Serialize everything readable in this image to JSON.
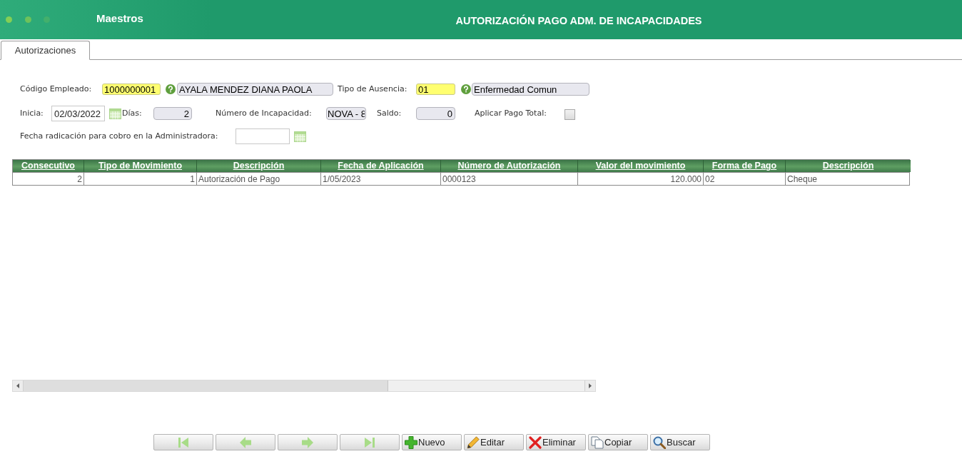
{
  "window": {
    "section": "Maestros",
    "title": "AUTORIZACIÓN PAGO ADM. DE INCAPACIDADES"
  },
  "tabs": [
    {
      "label": "Autorizaciones",
      "selected": true
    }
  ],
  "form": {
    "employee": {
      "label": "Código Empleado:",
      "code": "1000000001",
      "name": "AYALA MENDEZ DIANA PAOLA"
    },
    "absence_type": {
      "label": "Tipo de Ausencia:",
      "code": "01",
      "name": "Enfermedad Comun"
    },
    "start": {
      "label": "Inicia:",
      "value": "02/03/2022"
    },
    "days": {
      "label": "Días:",
      "value": "2"
    },
    "incapacity_number": {
      "label": "Número de Incapacidad:",
      "value": "NOVA - 8"
    },
    "balance": {
      "label": "Saldo:",
      "value": "0"
    },
    "full_payment": {
      "label": "Aplicar Pago Total:",
      "checked": false
    },
    "filing_date": {
      "label": "Fecha radicación para cobro en la Administradora:"
    }
  },
  "table": {
    "columns": [
      "Consecutivo",
      "Tipo de Movimiento",
      "Descripción",
      "Fecha de Aplicación",
      "Número de Autorización",
      "Valor del movimiento",
      "Forma de Pago",
      "Descripción"
    ],
    "rows": [
      [
        "2",
        "1",
        "Autorización de Pago",
        "1/05/2023",
        "0000123",
        "120.000",
        "02",
        "Cheque"
      ]
    ]
  },
  "toolbar": [
    {
      "kind": "first",
      "disabled": true
    },
    {
      "kind": "previous",
      "disabled": true
    },
    {
      "kind": "next",
      "disabled": true
    },
    {
      "kind": "last",
      "disabled": true
    },
    {
      "kind": "new",
      "label": "Nuevo",
      "disabled": false
    },
    {
      "kind": "edit",
      "label": "Editar",
      "disabled": false
    },
    {
      "kind": "delete",
      "label": "Eliminar",
      "disabled": false
    },
    {
      "kind": "copy",
      "label": "Copiar",
      "disabled": false
    },
    {
      "kind": "search",
      "label": "Buscar",
      "disabled": false
    }
  ]
}
